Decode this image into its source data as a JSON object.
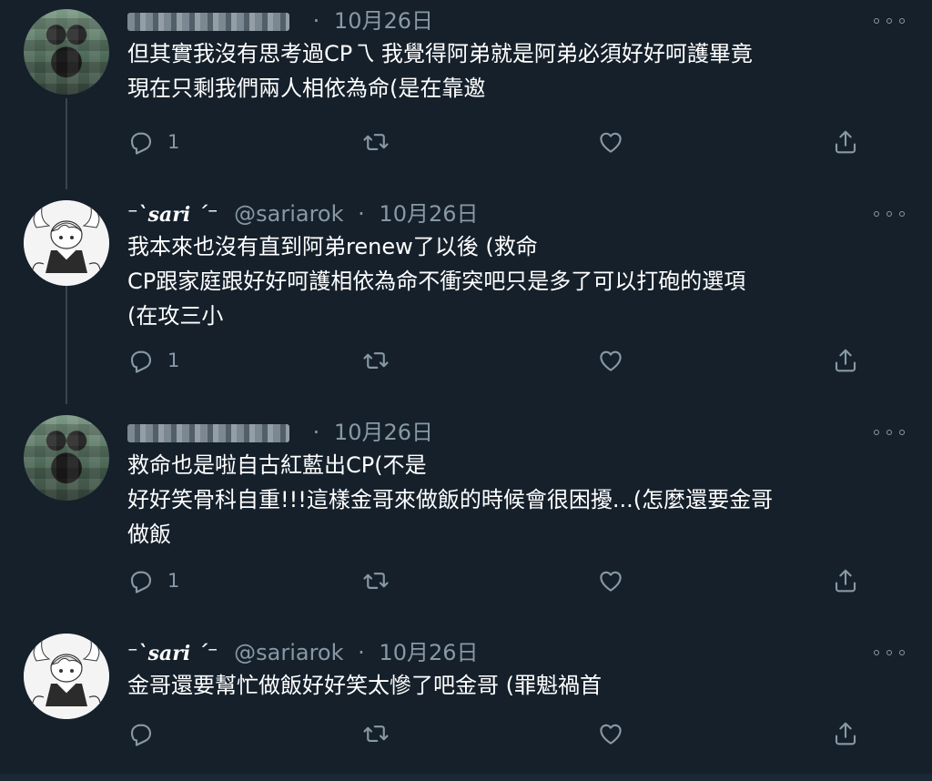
{
  "tweets": [
    {
      "author": "blurred",
      "handle": "",
      "date": "10月26日",
      "lines": [
        "但其實我沒有思考過CP乁 我覺得阿弟就是阿弟必須好好呵護畢竟",
        "現在只剩我們兩人相依為命(是在靠邀"
      ],
      "reply_count": "1"
    },
    {
      "author": "⁻`𝒔𝒂𝒓𝒊 ˊ⁻",
      "handle": "@sariarok",
      "date": "10月26日",
      "lines": [
        "我本來也沒有直到阿弟renew了以後 (救命",
        "CP跟家庭跟好好呵護相依為命不衝突吧只是多了可以打砲的選項",
        "(在攻三小"
      ],
      "reply_count": "1"
    },
    {
      "author": "blurred",
      "handle": "",
      "date": "10月26日",
      "lines": [
        "救命也是啦自古紅藍出CP(不是",
        "好好笑骨科自重!!!這樣金哥來做飯的時候會很困擾...(怎麼還要金哥",
        "做飯"
      ],
      "reply_count": "1"
    },
    {
      "author": "⁻`𝒔𝒂𝒓𝒊 ˊ⁻",
      "handle": "@sariarok",
      "date": "10月26日",
      "lines": [
        "金哥還要幫忙做飯好好笑太慘了吧金哥 (罪魁禍首"
      ],
      "reply_count": ""
    }
  ],
  "colors": {
    "background": "#15202b",
    "secondary_text": "#8899a6",
    "line": "#38444d"
  },
  "icons": [
    "reply-icon",
    "retweet-icon",
    "like-icon",
    "share-icon",
    "more-icon"
  ]
}
